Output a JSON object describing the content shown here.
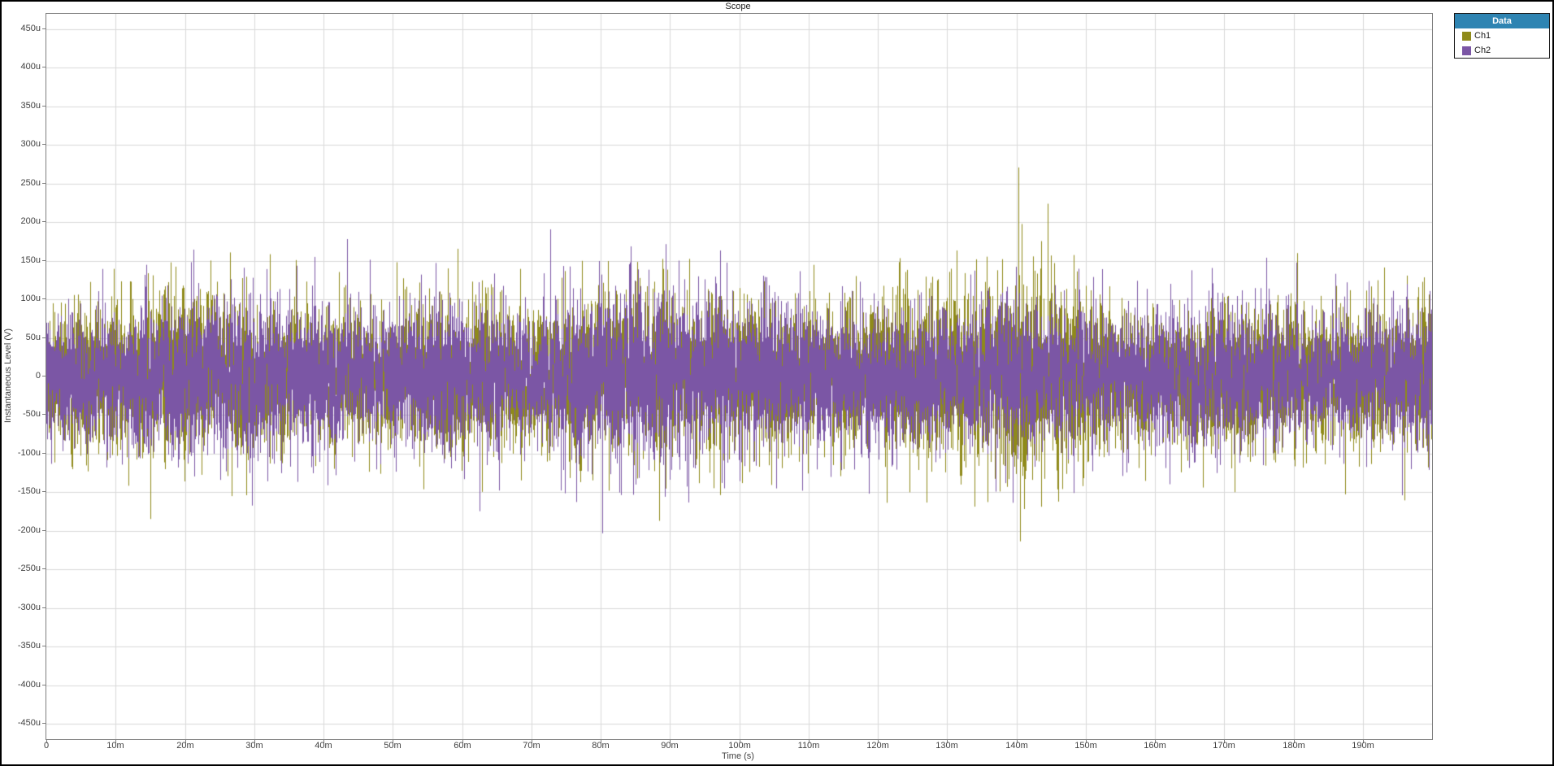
{
  "window": {
    "background": "#ffffff",
    "border_color": "#000000"
  },
  "chart": {
    "title": "Scope",
    "x_axis_label": "Time (s)",
    "y_axis_label": "Instantaneous Level (V)",
    "text_color": "#3f3f3f",
    "grid_color": "#d9d9d9",
    "plot_border_color": "#7f7f7f",
    "plot_background": "#ffffff"
  },
  "legend": {
    "header": "Data",
    "header_bg": "#2e84b2",
    "header_text_color": "#ffffff",
    "border_color": "#1a1a1a",
    "background": "#ffffff"
  },
  "chart_data": {
    "type": "line",
    "title": "Scope",
    "xlabel": "Time (s)",
    "ylabel": "Instantaneous Level (V)",
    "x_unit": "s",
    "y_unit": "V",
    "xlim_ms": [
      0,
      200
    ],
    "ylim_uV": [
      -470,
      470
    ],
    "grid": true,
    "legend_position": "outside-top-right",
    "x_tick_values_ms": [
      0,
      10,
      20,
      30,
      40,
      50,
      60,
      70,
      80,
      90,
      100,
      110,
      120,
      130,
      140,
      150,
      160,
      170,
      180,
      190
    ],
    "x_tick_labels": [
      "0",
      "10m",
      "20m",
      "30m",
      "40m",
      "50m",
      "60m",
      "70m",
      "80m",
      "90m",
      "100m",
      "110m",
      "120m",
      "130m",
      "140m",
      "150m",
      "160m",
      "170m",
      "180m",
      "190m"
    ],
    "y_tick_values_uV": [
      450,
      400,
      350,
      300,
      250,
      200,
      150,
      100,
      50,
      0,
      -50,
      -100,
      -150,
      -200,
      -250,
      -300,
      -350,
      -400,
      -450
    ],
    "y_tick_labels": [
      "450u",
      "400u",
      "350u",
      "300u",
      "250u",
      "200u",
      "150u",
      "100u",
      "50u",
      "0",
      "-50u",
      "-100u",
      "-150u",
      "-200u",
      "-250u",
      "-300u",
      "-350u",
      "-400u",
      "-450u"
    ],
    "series": [
      {
        "name": "Ch1",
        "color": "#8f8a1a",
        "waveform": "random-noise",
        "envelope_times_ms": [
          0,
          10,
          20,
          30,
          40,
          50,
          60,
          70,
          80,
          90,
          100,
          110,
          120,
          130,
          140,
          150,
          160,
          170,
          180,
          190,
          200
        ],
        "peak_envelope_uV": [
          115,
          145,
          160,
          140,
          130,
          135,
          155,
          135,
          150,
          165,
          155,
          120,
          145,
          175,
          200,
          150,
          130,
          135,
          130,
          125,
          140
        ]
      },
      {
        "name": "Ch2",
        "color": "#7b56a5",
        "waveform": "random-noise",
        "envelope_times_ms": [
          0,
          10,
          20,
          30,
          40,
          50,
          60,
          70,
          80,
          90,
          100,
          110,
          120,
          130,
          140,
          150,
          160,
          170,
          180,
          190,
          200
        ],
        "peak_envelope_uV": [
          120,
          130,
          155,
          150,
          140,
          130,
          145,
          130,
          165,
          170,
          135,
          135,
          130,
          140,
          150,
          140,
          130,
          140,
          130,
          130,
          155
        ]
      }
    ]
  }
}
